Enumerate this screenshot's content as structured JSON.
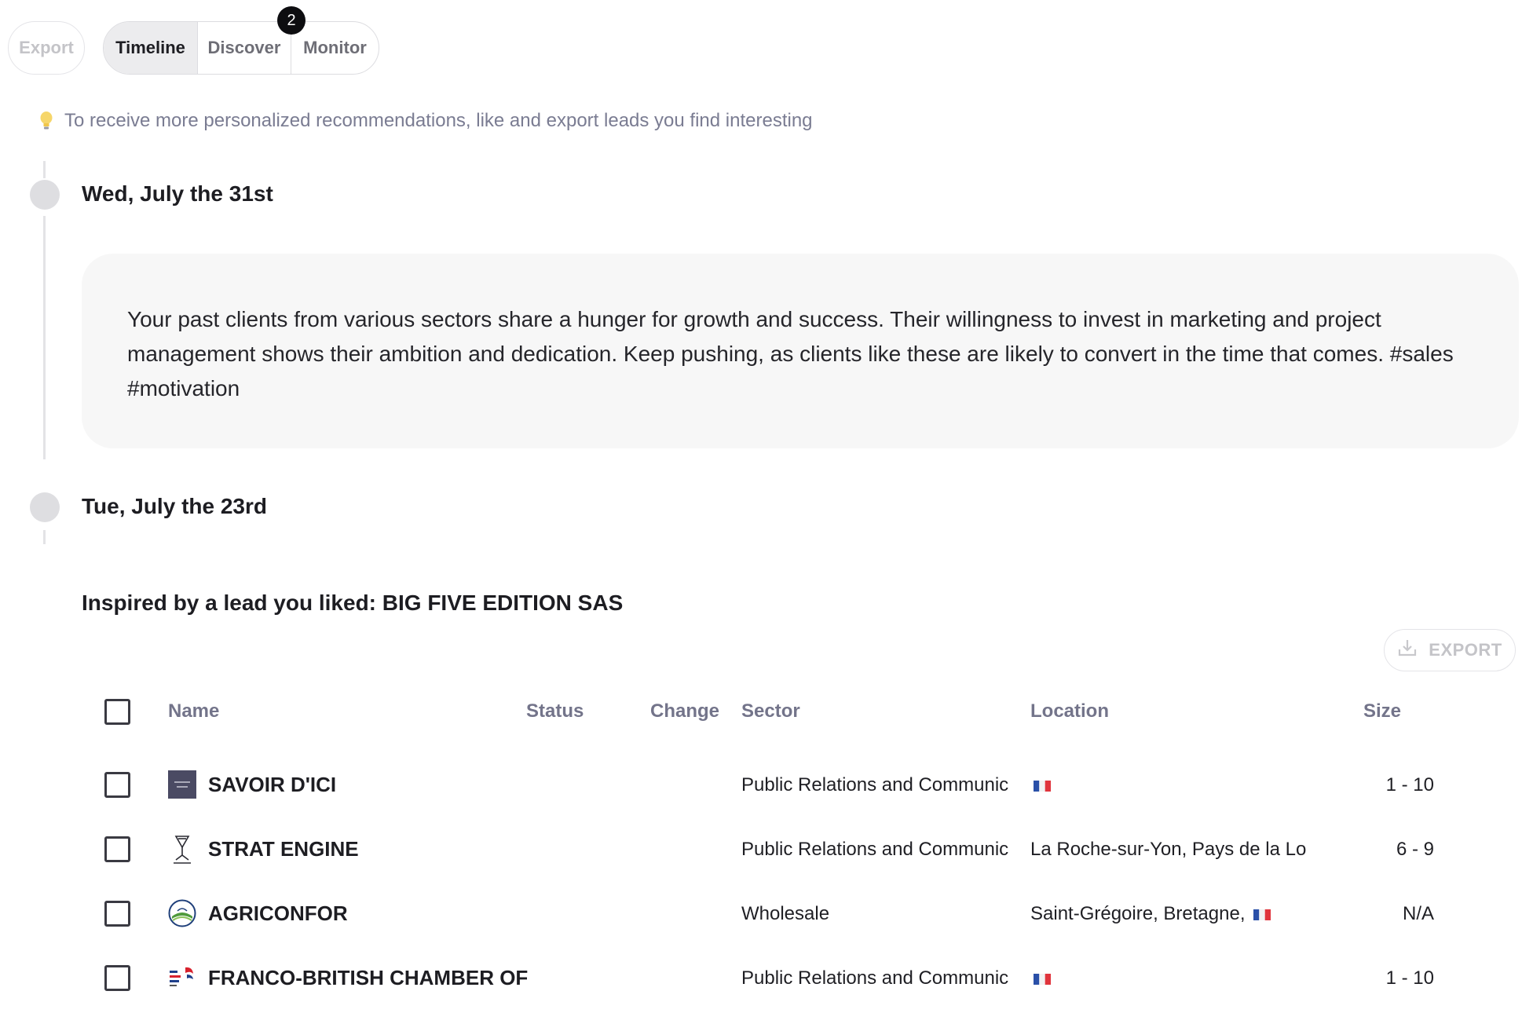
{
  "toolbar": {
    "export_label": "Export",
    "tabs": [
      {
        "label": "Timeline",
        "active": true
      },
      {
        "label": "Discover",
        "active": false
      },
      {
        "label": "Monitor",
        "active": false
      }
    ],
    "badge_count": "2"
  },
  "tip": {
    "icon": "lightbulb-icon",
    "text": "To receive more personalized recommendations, like and export leads you find interesting"
  },
  "timeline": {
    "entries": [
      {
        "date": "Wed, July the 31st",
        "message": "Your past clients from various sectors share a hunger for growth and success. Their willingness to invest in marketing and project management shows their ambition and dedication. Keep pushing, as clients like these are likely to convert in the time that comes. #sales #motivation"
      },
      {
        "date": "Tue, July the 23rd"
      }
    ]
  },
  "leads": {
    "title": "Inspired by a lead you liked: BIG FIVE EDITION SAS",
    "export_label": "EXPORT",
    "columns": {
      "name": "Name",
      "status": "Status",
      "change": "Change",
      "sector": "Sector",
      "location": "Location",
      "size": "Size"
    },
    "rows": [
      {
        "name": "SAVOIR D'ICI",
        "logo": "savoir-dici-logo",
        "sector": "Public Relations and Communic",
        "location": "",
        "flag": "france-flag",
        "size": "1 - 10"
      },
      {
        "name": "STRAT ENGINE",
        "logo": "strat-engine-logo",
        "sector": "Public Relations and Communic",
        "location": "La Roche-sur-Yon, Pays de la Lo",
        "flag": "",
        "size": "6 - 9"
      },
      {
        "name": "AGRICONFOR",
        "logo": "agriconfor-logo",
        "sector": "Wholesale",
        "location": "Saint-Grégoire, Bretagne,",
        "flag": "france-flag",
        "size": "N/A"
      },
      {
        "name": "FRANCO-BRITISH CHAMBER OF",
        "logo": "franco-british-logo",
        "sector": "Public Relations and Communic",
        "location": "",
        "flag": "france-flag",
        "size": "1 - 10"
      }
    ]
  },
  "colors": {
    "accent_dark": "#0d0d10",
    "muted_text": "#7a7c92",
    "card_bg": "#f7f7f7",
    "timeline_dot": "#dedee1"
  }
}
